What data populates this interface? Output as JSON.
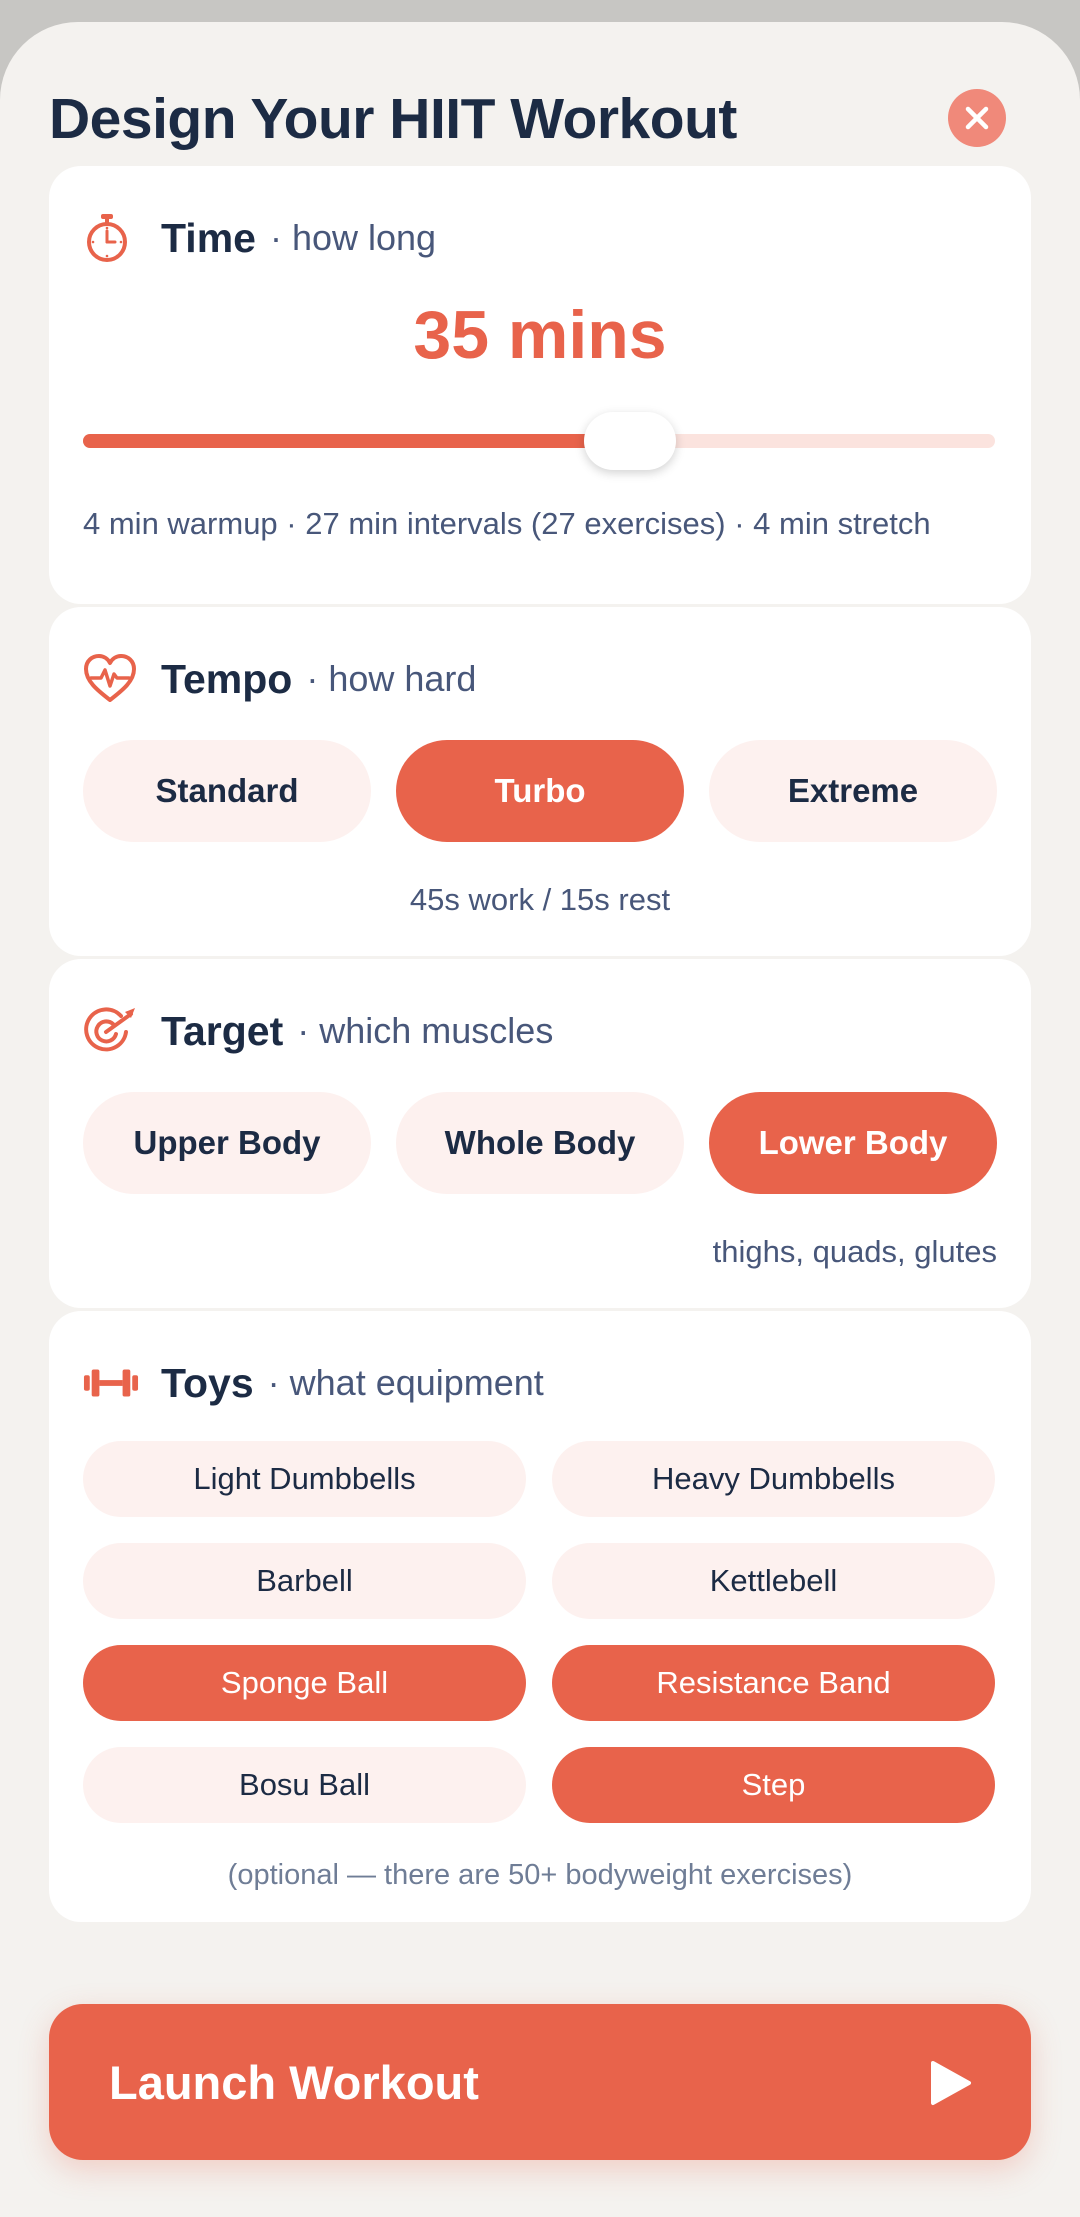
{
  "header": {
    "title": "Design Your HIIT Workout"
  },
  "colors": {
    "accent": "#e8634b",
    "accent_soft": "#fdf1ef",
    "text": "#1c2b44",
    "muted": "#48577a"
  },
  "time": {
    "icon": "stopwatch-icon",
    "label": "Time",
    "sub": "· how long",
    "value": "35 mins",
    "slider_fraction": 0.6,
    "breakdown": "4 min warmup · 27 min intervals (27 exercises) · 4 min stretch"
  },
  "tempo": {
    "icon": "heart-pulse-icon",
    "label": "Tempo",
    "sub": "· how hard",
    "options": [
      "Standard",
      "Turbo",
      "Extreme"
    ],
    "selected": "Turbo",
    "note": "45s work / 15s rest"
  },
  "target": {
    "icon": "target-arrow-icon",
    "label": "Target",
    "sub": "· which muscles",
    "options": [
      "Upper Body",
      "Whole Body",
      "Lower Body"
    ],
    "selected": "Lower Body",
    "note": "thighs, quads, glutes"
  },
  "toys": {
    "icon": "dumbbell-icon",
    "label": "Toys",
    "sub": "· what equipment",
    "items": [
      {
        "label": "Light Dumbbells",
        "selected": false
      },
      {
        "label": "Heavy Dumbbells",
        "selected": false
      },
      {
        "label": "Barbell",
        "selected": false
      },
      {
        "label": "Kettlebell",
        "selected": false
      },
      {
        "label": "Sponge Ball",
        "selected": true
      },
      {
        "label": "Resistance Band",
        "selected": true
      },
      {
        "label": "Bosu Ball",
        "selected": false
      },
      {
        "label": "Step",
        "selected": true
      }
    ],
    "note": "(optional — there are 50+ bodyweight exercises)"
  },
  "launch": {
    "label": "Launch Workout",
    "icon": "play-icon"
  }
}
